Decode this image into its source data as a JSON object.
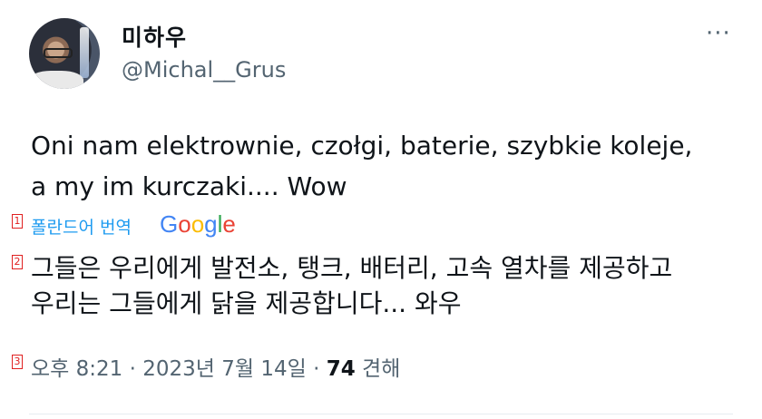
{
  "user": {
    "display_name": "미하우",
    "handle": "@Michal__Grus"
  },
  "more_icon": "···",
  "tweet": {
    "line1": "Oni nam elektrownie, czołgi, baterie, szybkie koleje,",
    "line2": "a my im kurczaki.... Wow"
  },
  "markers": [
    "1",
    "2",
    "3"
  ],
  "translation": {
    "label": "폴란드어 번역",
    "provider_letters": [
      "G",
      "o",
      "o",
      "g",
      "l",
      "e"
    ],
    "line1": "그들은 우리에게 발전소, 탱크, 배터리, 고속 열차를 제공하고",
    "line2": "우리는 그들에게 닭을 제공합니다... 와우"
  },
  "meta": {
    "time": "오후 8:21",
    "sep1": " · ",
    "date": "2023년 7월 14일",
    "sep2": " · ",
    "views_count": "74",
    "views_label": " 견해"
  },
  "colors": {
    "link_blue": "#1d9bf0",
    "secondary_text": "#536471",
    "primary_text": "#0f1419",
    "marker_red": "#e02020"
  }
}
